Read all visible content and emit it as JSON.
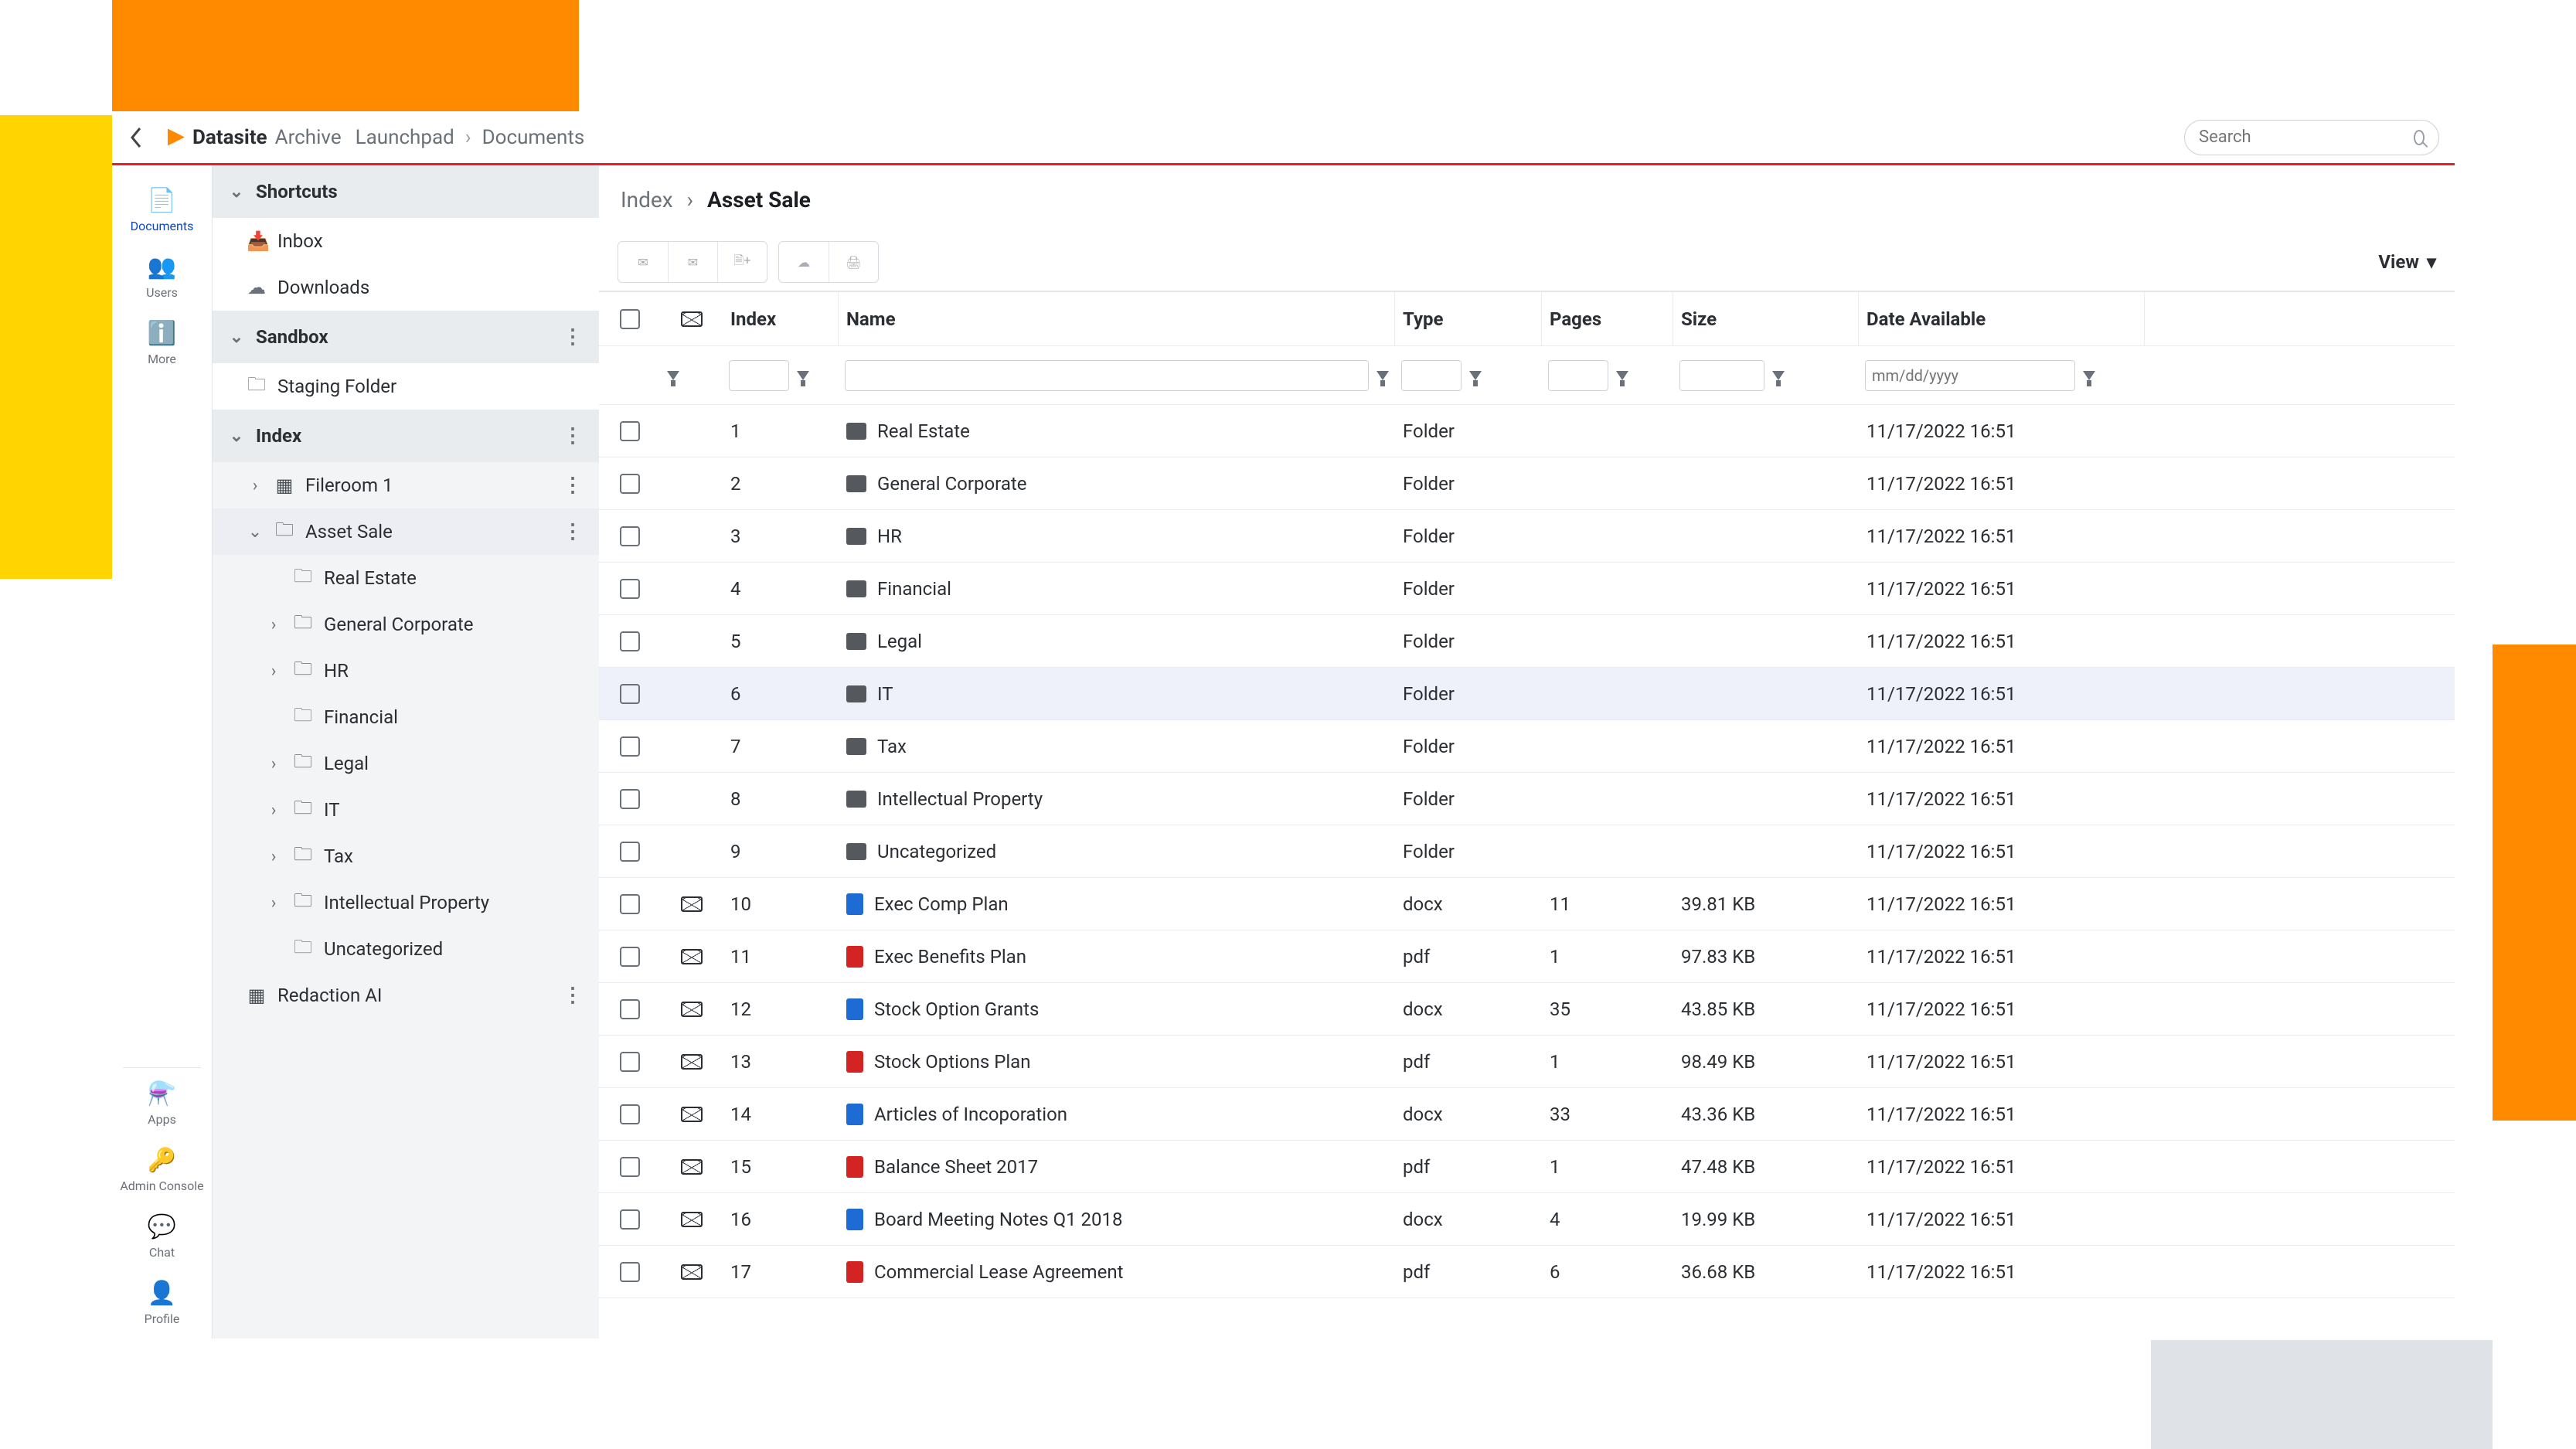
{
  "topbar": {
    "brand_bold": "Datasite",
    "brand_light": "Archive",
    "crumb_root": "Launchpad",
    "crumb_leaf": "Documents",
    "search_placeholder": "Search"
  },
  "rail_top": [
    {
      "key": "documents",
      "label": "Documents",
      "icon": "📄",
      "active": true
    },
    {
      "key": "users",
      "label": "Users",
      "icon": "👥",
      "active": false
    },
    {
      "key": "more",
      "label": "More",
      "icon": "ℹ️",
      "active": false
    }
  ],
  "rail_bottom": [
    {
      "key": "apps",
      "label": "Apps",
      "icon": "⚗️"
    },
    {
      "key": "admin",
      "label": "Admin Console",
      "icon": "🔑"
    },
    {
      "key": "chat",
      "label": "Chat",
      "icon": "💬"
    },
    {
      "key": "profile",
      "label": "Profile",
      "icon": "👤"
    }
  ],
  "tree": {
    "shortcuts_label": "Shortcuts",
    "inbox_label": "Inbox",
    "downloads_label": "Downloads",
    "sandbox_label": "Sandbox",
    "staging_label": "Staging Folder",
    "index_label": "Index",
    "fileroom_label": "Fileroom 1",
    "asset_sale_label": "Asset Sale",
    "asset_children": [
      {
        "label": "Real Estate",
        "outline": true
      },
      {
        "label": "General Corporate",
        "outline": false,
        "expandable": true
      },
      {
        "label": "HR",
        "outline": false,
        "expandable": true
      },
      {
        "label": "Financial",
        "outline": true
      },
      {
        "label": "Legal",
        "outline": false,
        "expandable": true
      },
      {
        "label": "IT",
        "outline": false,
        "expandable": true
      },
      {
        "label": "Tax",
        "outline": false,
        "expandable": true
      },
      {
        "label": "Intellectual Property",
        "outline": false,
        "expandable": true
      },
      {
        "label": "Uncategorized",
        "outline": true
      }
    ],
    "redaction_label": "Redaction AI"
  },
  "breadcrumb": {
    "root": "Index",
    "current": "Asset Sale"
  },
  "view_label": "View",
  "columns": {
    "index": "Index",
    "name": "Name",
    "type": "Type",
    "pages": "Pages",
    "size": "Size",
    "date": "Date Available"
  },
  "filter_date_placeholder": "mm/dd/yyyy",
  "rows": [
    {
      "idx": "1",
      "name": "Real Estate",
      "type": "Folder",
      "pages": "",
      "size": "",
      "date": "11/17/2022 16:51",
      "ftype": "folder",
      "env": false
    },
    {
      "idx": "2",
      "name": "General Corporate",
      "type": "Folder",
      "pages": "",
      "size": "",
      "date": "11/17/2022 16:51",
      "ftype": "folder",
      "env": false
    },
    {
      "idx": "3",
      "name": "HR",
      "type": "Folder",
      "pages": "",
      "size": "",
      "date": "11/17/2022 16:51",
      "ftype": "folder",
      "env": false
    },
    {
      "idx": "4",
      "name": "Financial",
      "type": "Folder",
      "pages": "",
      "size": "",
      "date": "11/17/2022 16:51",
      "ftype": "folder",
      "env": false
    },
    {
      "idx": "5",
      "name": "Legal",
      "type": "Folder",
      "pages": "",
      "size": "",
      "date": "11/17/2022 16:51",
      "ftype": "folder",
      "env": false
    },
    {
      "idx": "6",
      "name": "IT",
      "type": "Folder",
      "pages": "",
      "size": "",
      "date": "11/17/2022 16:51",
      "ftype": "folder",
      "env": false,
      "hover": true
    },
    {
      "idx": "7",
      "name": "Tax",
      "type": "Folder",
      "pages": "",
      "size": "",
      "date": "11/17/2022 16:51",
      "ftype": "folder",
      "env": false
    },
    {
      "idx": "8",
      "name": "Intellectual Property",
      "type": "Folder",
      "pages": "",
      "size": "",
      "date": "11/17/2022 16:51",
      "ftype": "folder",
      "env": false
    },
    {
      "idx": "9",
      "name": "Uncategorized",
      "type": "Folder",
      "pages": "",
      "size": "",
      "date": "11/17/2022 16:51",
      "ftype": "folder",
      "env": false
    },
    {
      "idx": "10",
      "name": "Exec Comp Plan",
      "type": "docx",
      "pages": "11",
      "size": "39.81 KB",
      "date": "11/17/2022 16:51",
      "ftype": "docx",
      "env": true
    },
    {
      "idx": "11",
      "name": "Exec Benefits Plan",
      "type": "pdf",
      "pages": "1",
      "size": "97.83 KB",
      "date": "11/17/2022 16:51",
      "ftype": "pdf",
      "env": true
    },
    {
      "idx": "12",
      "name": "Stock Option Grants",
      "type": "docx",
      "pages": "35",
      "size": "43.85 KB",
      "date": "11/17/2022 16:51",
      "ftype": "docx",
      "env": true
    },
    {
      "idx": "13",
      "name": "Stock Options Plan",
      "type": "pdf",
      "pages": "1",
      "size": "98.49 KB",
      "date": "11/17/2022 16:51",
      "ftype": "pdf",
      "env": true
    },
    {
      "idx": "14",
      "name": "Articles of Incoporation",
      "type": "docx",
      "pages": "33",
      "size": "43.36 KB",
      "date": "11/17/2022 16:51",
      "ftype": "docx",
      "env": true
    },
    {
      "idx": "15",
      "name": "Balance Sheet 2017",
      "type": "pdf",
      "pages": "1",
      "size": "47.48 KB",
      "date": "11/17/2022 16:51",
      "ftype": "pdf",
      "env": true
    },
    {
      "idx": "16",
      "name": "Board Meeting Notes Q1 2018",
      "type": "docx",
      "pages": "4",
      "size": "19.99 KB",
      "date": "11/17/2022 16:51",
      "ftype": "docx",
      "env": true
    },
    {
      "idx": "17",
      "name": "Commercial Lease Agreement",
      "type": "pdf",
      "pages": "6",
      "size": "36.68 KB",
      "date": "11/17/2022 16:51",
      "ftype": "pdf",
      "env": true
    }
  ]
}
